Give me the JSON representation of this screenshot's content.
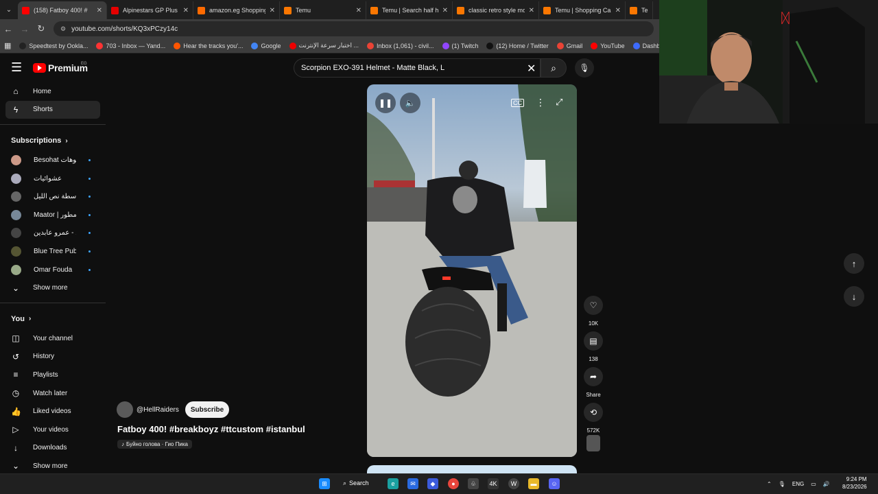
{
  "browser": {
    "tabs": [
      {
        "title": "(158) Fatboy 400! #",
        "color": "#ff0000",
        "active": true
      },
      {
        "title": "Alpinestars GP Plus R",
        "color": "#e60000",
        "active": false
      },
      {
        "title": "amazon.eg Shopping",
        "color": "#ff6a00",
        "active": false
      },
      {
        "title": "Temu",
        "color": "#fb7701",
        "active": false
      },
      {
        "title": "Temu | Search half helm",
        "color": "#fb7701",
        "active": false
      },
      {
        "title": "classic retro style moto",
        "color": "#fb7701",
        "active": false
      },
      {
        "title": "Temu | Shopping Cart",
        "color": "#fb7701",
        "active": false
      },
      {
        "title": "Temu",
        "color": "#fb7701",
        "active": false
      }
    ],
    "url": "youtube.com/shorts/KQ3xPCzy14c",
    "bookmarks": [
      {
        "label": "Speedtest by Ookla...",
        "color": "#222"
      },
      {
        "label": "703 - Inbox — Yand...",
        "color": "#f33"
      },
      {
        "label": "Hear the tracks you'...",
        "color": "#f50"
      },
      {
        "label": "Google",
        "color": "#4285f4"
      },
      {
        "label": "اختبار سرعة الإنترنت ...",
        "color": "#e00"
      },
      {
        "label": "Inbox (1,061) - civil...",
        "color": "#ea4335"
      },
      {
        "label": "(1) Twitch",
        "color": "#9146ff"
      },
      {
        "label": "(12) Home / Twitter",
        "color": "#111"
      },
      {
        "label": "Gmail",
        "color": "#ea4335"
      },
      {
        "label": "YouTube",
        "color": "#f00"
      },
      {
        "label": "Dashboard - Restre...",
        "color": "#3d6bff"
      }
    ]
  },
  "youtube": {
    "logo_text": "Premium",
    "logo_region": "EG",
    "search_value": "Scorpion EXO-391 Helmet - Matte Black, L",
    "sidebar": {
      "main": [
        {
          "label": "Home",
          "icon": "⌂",
          "name": "home"
        },
        {
          "label": "Shorts",
          "icon": "ϟ",
          "name": "shorts",
          "active": true
        }
      ],
      "subscriptions_title": "Subscriptions",
      "subscriptions": [
        {
          "label": "Besohat بيسوهات",
          "color": "#c98"
        },
        {
          "label": "عشوائيات",
          "color": "#aab"
        },
        {
          "label": "أسطة نص الليل",
          "color": "#666"
        },
        {
          "label": "Maator | مُعاذ مطور",
          "color": "#789"
        },
        {
          "label": "حكاوي - عمرو عابدين",
          "color": "#444"
        },
        {
          "label": "Blue Tree Publis...",
          "color": "#553"
        },
        {
          "label": "Omar Fouda",
          "color": "#9a8"
        }
      ],
      "show_more_1": "Show more",
      "you_title": "You",
      "you": [
        {
          "label": "Your channel",
          "icon": "◫",
          "name": "your-channel"
        },
        {
          "label": "History",
          "icon": "↺",
          "name": "history"
        },
        {
          "label": "Playlists",
          "icon": "≡",
          "name": "playlists"
        },
        {
          "label": "Watch later",
          "icon": "◷",
          "name": "watch-later"
        },
        {
          "label": "Liked videos",
          "icon": "👍",
          "name": "liked-videos"
        },
        {
          "label": "Your videos",
          "icon": "▷",
          "name": "your-videos"
        },
        {
          "label": "Downloads",
          "icon": "↓",
          "name": "downloads"
        }
      ],
      "show_more_2": "Show more"
    },
    "short": {
      "channel": "@HellRaiders",
      "subscribe": "Subscribe",
      "title": "Fatboy 400! #breakboyz #ttcustom #istanbul",
      "music": "Буйно голова · Гио Пика",
      "likes": "10K",
      "comments": "138",
      "share": "Share",
      "remix": "572K"
    }
  },
  "taskbar": {
    "search": "Search",
    "language": "ENG",
    "time": "9:24 PM",
    "date": "8/23/2026"
  }
}
